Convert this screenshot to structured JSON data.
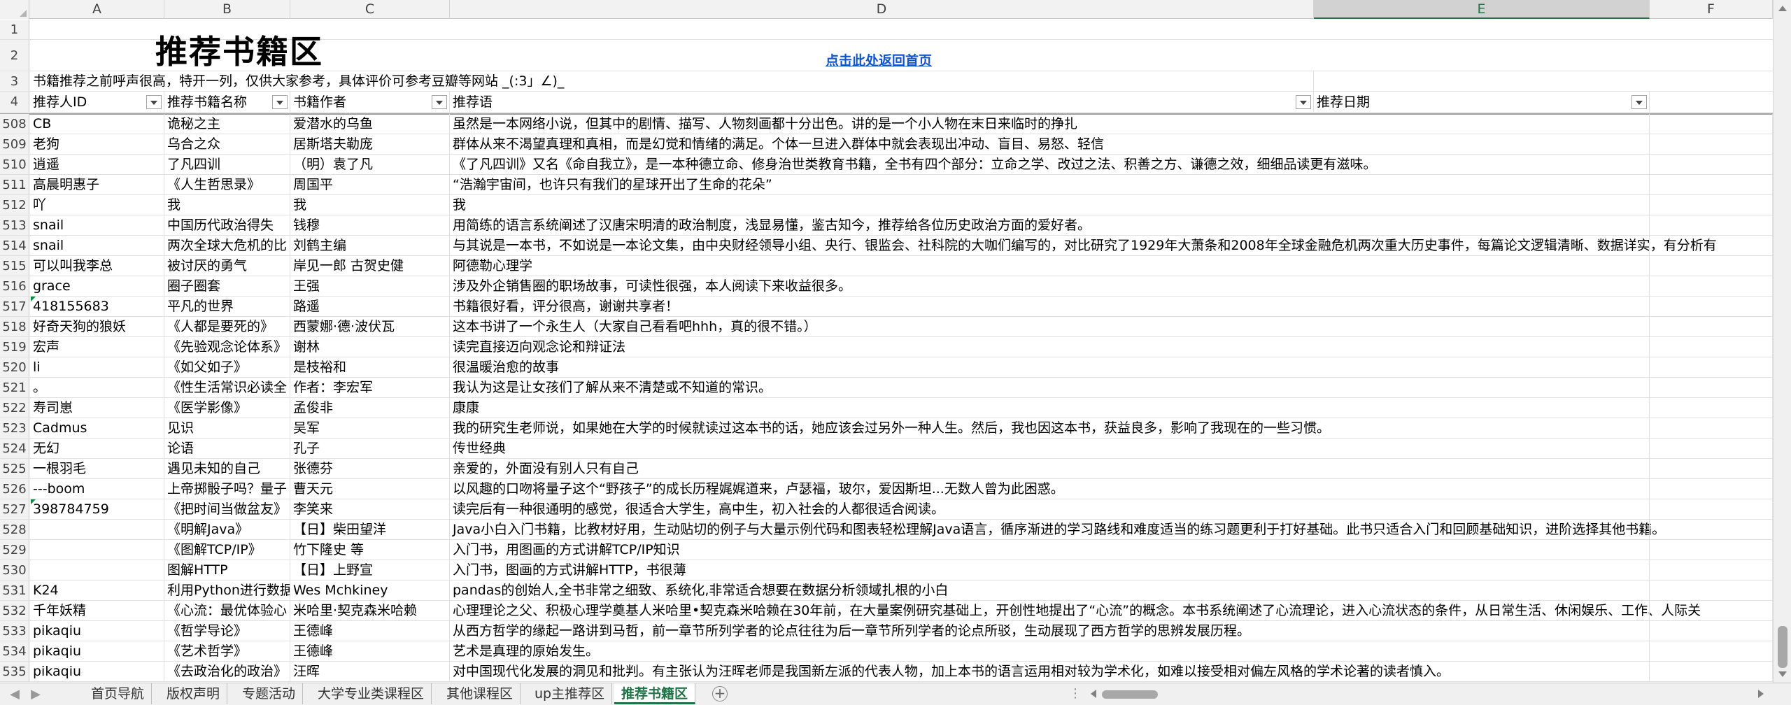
{
  "columns": [
    "A",
    "B",
    "C",
    "D",
    "E",
    "F"
  ],
  "selected_column": "E",
  "title": "推荐书籍区",
  "home_link": "点击此处返回首页",
  "note": "书籍推荐之前呼声很高，特开一列，仅供大家参考，具体评价可参考豆瓣等网站 _(:3」∠)_",
  "header_row": {
    "row_num": "4",
    "a": "推荐人ID",
    "b": "推荐书籍名称",
    "c": "书籍作者",
    "d": "推荐语",
    "e": "推荐日期"
  },
  "rows": [
    {
      "n": "508",
      "a": "CB",
      "b": "诡秘之主",
      "c": "爱潜水的乌鱼",
      "d": "虽然是一本网络小说，但其中的剧情、描写、人物刻画都十分出色。讲的是一个小人物在末日来临时的挣扎"
    },
    {
      "n": "509",
      "a": "老狗",
      "b": "乌合之众",
      "c": "居斯塔夫勒庞",
      "d": "群体从来不渴望真理和真相，而是幻觉和情绪的满足。个体一旦进入群体中就会表现出冲动、盲目、易怒、轻信"
    },
    {
      "n": "510",
      "a": "逍遥",
      "b": "了凡四训",
      "c": "（明）袁了凡",
      "d": "《了凡四训》又名《命自我立》，是一本种德立命、修身治世类教育书籍，全书有四个部分：立命之学、改过之法、积善之方、谦德之效，细细品读更有滋味。"
    },
    {
      "n": "511",
      "a": "高晨明惠子",
      "b": "《人生哲思录》",
      "c": "周国平",
      "d": "“浩瀚宇宙间，也许只有我们的星球开出了生命的花朵”"
    },
    {
      "n": "512",
      "a": "吖",
      "b": "我",
      "c": "我",
      "d": "我"
    },
    {
      "n": "513",
      "a": "snail",
      "b": "中国历代政治得失",
      "c": "钱穆",
      "d": "用简练的语言系统阐述了汉唐宋明清的政治制度，浅显易懂，鉴古知今，推荐给各位历史政治方面的爱好者。"
    },
    {
      "n": "514",
      "a": "snail",
      "b": "两次全球大危机的比",
      "c": "刘鹤主编",
      "d": "与其说是一本书，不如说是一本论文集，由中央财经领导小组、央行、银监会、社科院的大咖们编写的，对比研究了1929年大萧条和2008年全球金融危机两次重大历史事件，每篇论文逻辑清晰、数据详实，有分析有"
    },
    {
      "n": "515",
      "a": "可以叫我李总",
      "b": "被讨厌的勇气",
      "c": "岸见一郎  古贺史健",
      "d": "阿德勒心理学"
    },
    {
      "n": "516",
      "a": "grace",
      "b": "圈子圈套",
      "c": "王强",
      "d": "涉及外企销售圈的职场故事，可读性很强，本人阅读下来收益很多。"
    },
    {
      "n": "517",
      "a": "418155683",
      "b": "平凡的世界",
      "c": "路遥",
      "d": "书籍很好看，评分很高，谢谢共享者！"
    },
    {
      "n": "518",
      "a": "好奇天狗的狼妖",
      "b": "《人都是要死的》",
      "c": "西蒙娜·德·波伏瓦",
      "d": "这本书讲了一个永生人（大家自己看看吧hhh，真的很不错。）"
    },
    {
      "n": "519",
      "a": "宏声",
      "b": "《先验观念论体系》",
      "c": "谢林",
      "d": "读完直接迈向观念论和辩证法"
    },
    {
      "n": "520",
      "a": "li",
      "b": "《如父如子》",
      "c": "是枝裕和",
      "d": "很温暖治愈的故事"
    },
    {
      "n": "521",
      "a": "。",
      "b": "《性生活常识必读全",
      "c": "作者：李宏军",
      "d": "我认为这是让女孩们了解从来不清楚或不知道的常识。"
    },
    {
      "n": "522",
      "a": "寿司崽",
      "b": "《医学影像》",
      "c": "孟俊非",
      "d": "康康"
    },
    {
      "n": "523",
      "a": "Cadmus",
      "b": "见识",
      "c": "吴军",
      "d": "我的研究生老师说，如果她在大学的时候就读过这本书的话，她应该会过另外一种人生。然后，我也因这本书，获益良多，影响了我现在的一些习惯。"
    },
    {
      "n": "524",
      "a": "无幻",
      "b": "论语",
      "c": "孔子",
      "d": "传世经典"
    },
    {
      "n": "525",
      "a": "一根羽毛",
      "b": "遇见未知的自己",
      "c": "张德芬",
      "d": "亲爱的，外面没有别人只有自己"
    },
    {
      "n": "526",
      "a": "---boom",
      "b": "上帝掷骰子吗？量子",
      "c": "曹天元",
      "d": "以风趣的口吻将量子这个“野孩子”的成长历程娓娓道来，卢瑟福，玻尔，爱因斯坦...无数人曾为此困惑。"
    },
    {
      "n": "527",
      "a": "398784759",
      "b": "《把时间当做盆友》",
      "c": "李笑来",
      "d": "读完后有一种很通明的感觉，很适合大学生，高中生，初入社会的人都很适合阅读。"
    },
    {
      "n": "528",
      "a": "",
      "b": "《明解Java》",
      "c": "【日】柴田望洋",
      "d": "Java小白入门书籍，比教材好用，生动贴切的例子与大量示例代码和图表轻松理解Java语言，循序渐进的学习路线和难度适当的练习题更利于打好基础。此书只适合入门和回顾基础知识，进阶选择其他书籍。"
    },
    {
      "n": "529",
      "a": "",
      "b": "《图解TCP/IP》",
      "c": "竹下隆史 等",
      "d": "入门书，用图画的方式讲解TCP/IP知识"
    },
    {
      "n": "530",
      "a": "",
      "b": "图解HTTP",
      "c": "【日】上野宣",
      "d": "入门书，图画的方式讲解HTTP，书很薄"
    },
    {
      "n": "531",
      "a": "K24",
      "b": "利用Python进行数据",
      "c": "Wes Mchkiney",
      "d": "pandas的创始人,全书非常之细致、系统化,非常适合想要在数据分析领域扎根的小白"
    },
    {
      "n": "532",
      "a": "千年妖精",
      "b": "《心流：最优体验心",
      "c": "米哈里·契克森米哈赖",
      "d": "心理理论之父、积极心理学奠基人米哈里•契克森米哈赖在30年前，在大量案例研究基础上，开创性地提出了“心流”的概念。本书系统阐述了心流理论，进入心流状态的条件，从日常生活、休闲娱乐、工作、人际关"
    },
    {
      "n": "533",
      "a": "pikaqiu",
      "b": "《哲学导论》",
      "c": "王德峰",
      "d": "从西方哲学的缘起一路讲到马哲，前一章节所列学者的论点往往为后一章节所列学者的论点所驳，生动展现了西方哲学的思辨发展历程。"
    },
    {
      "n": "534",
      "a": "pikaqiu",
      "b": "《艺术哲学》",
      "c": "王德峰",
      "d": "艺术是真理的原始发生。"
    },
    {
      "n": "535",
      "a": "pikaqiu",
      "b": "《去政治化的政治》",
      "c": "汪晖",
      "d": "对中国现代化发展的洞见和批判。有主张认为汪晖老师是我国新左派的代表人物，加上本书的语言运用相对较为学术化，如难以接受相对偏左风格的学术论著的读者慎入。"
    }
  ],
  "tabs": [
    "首页导航",
    "版权声明",
    "专题活动",
    "大学专业类课程区",
    "其他课程区",
    "up主推荐区",
    "推荐书籍区"
  ],
  "active_tab": "推荐书籍区"
}
